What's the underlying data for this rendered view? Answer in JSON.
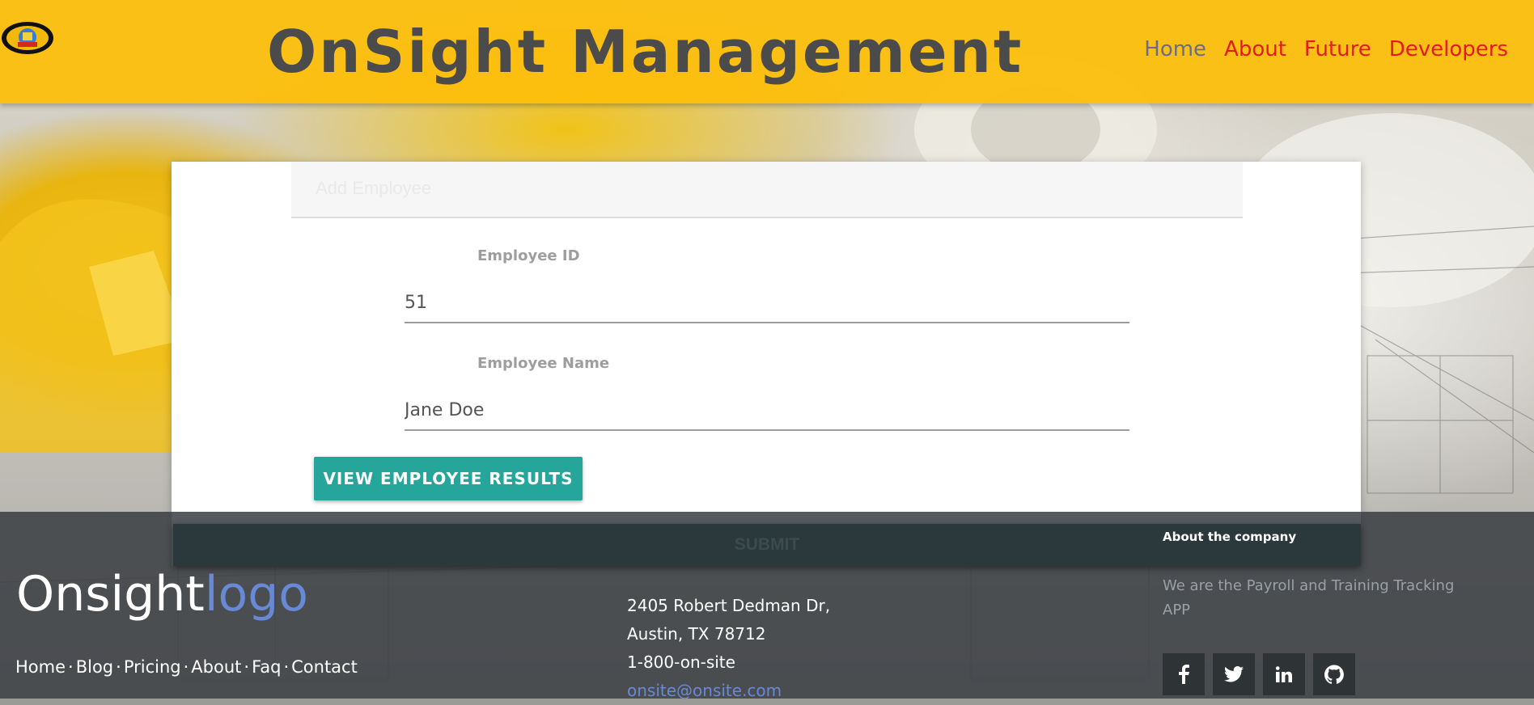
{
  "header": {
    "logo_text": "OnSight",
    "title": "OnSight Management",
    "nav": [
      {
        "label": "Home"
      },
      {
        "label": "About"
      },
      {
        "label": "Future"
      },
      {
        "label": "Developers"
      }
    ]
  },
  "form": {
    "header_label": "Add Employee",
    "employee_id_label": "Employee ID",
    "employee_id_value": "51",
    "employee_name_label": "Employee Name",
    "employee_name_value": "Jane Doe",
    "view_button_label": "VIEW EMPLOYEE RESULTS",
    "submit_label": "SUBMIT"
  },
  "footer": {
    "brand": "Onsight",
    "brand_accent": "logo",
    "links": [
      "Home",
      "Blog",
      "Pricing",
      "About",
      "Faq",
      "Contact"
    ],
    "address_line1": "2405 Robert Dedman Dr,",
    "address_line2": "Austin, TX 78712",
    "phone": "1-800-on-site",
    "email": "onsite@onsite.com",
    "about_title": "About the company",
    "about_text": "We are the Payroll and Training Tracking APP",
    "socials": [
      "facebook-icon",
      "twitter-icon",
      "linkedin-icon",
      "github-icon"
    ]
  },
  "colors": {
    "header_bg": "#FDBE0A",
    "title_text": "#4B4B4B",
    "nav_link": "#E51B1B",
    "nav_active": "#6C6C8A",
    "button_teal": "#26A69A",
    "footer_bg": "#3A3E42",
    "footer_accent": "#6889D6"
  }
}
